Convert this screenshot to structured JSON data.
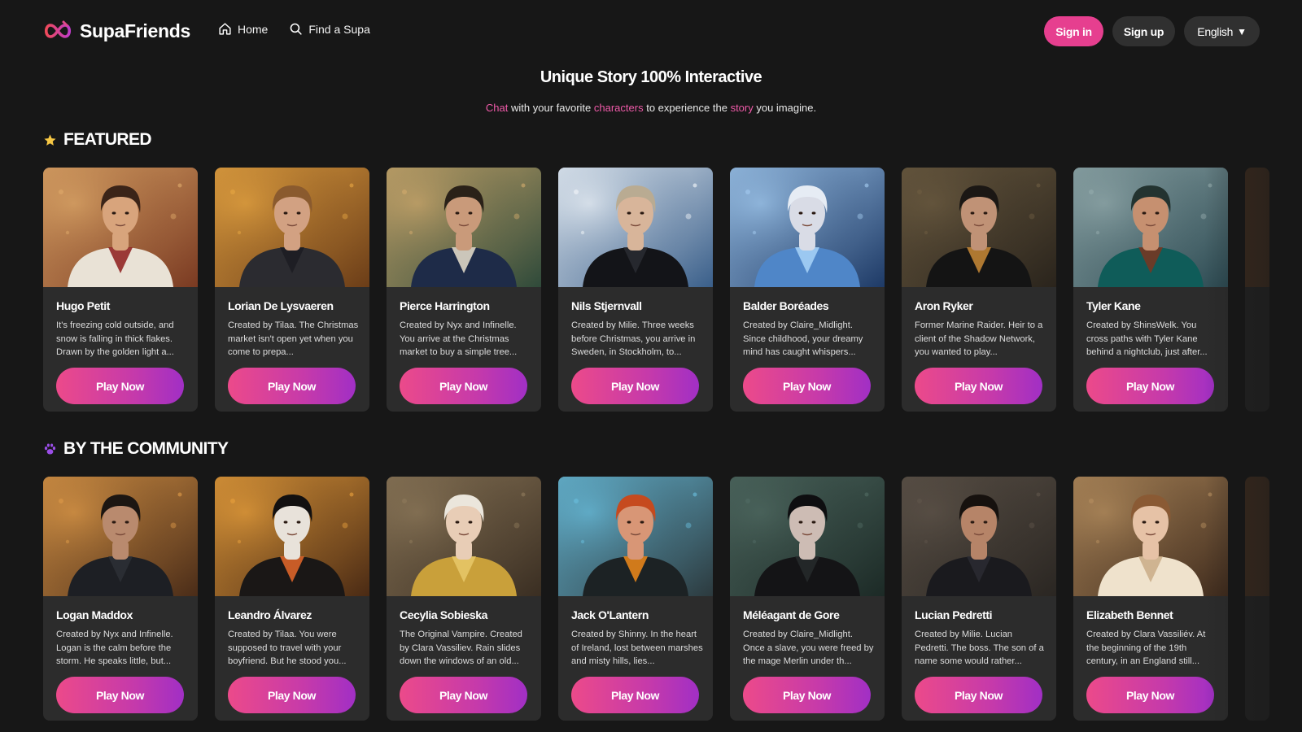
{
  "brand": {
    "name": "SupaFriends",
    "accent": "#e63f8f"
  },
  "nav": {
    "home": {
      "label": "Home",
      "icon": "home-icon"
    },
    "find": {
      "label": "Find a Supa",
      "icon": "search-icon"
    }
  },
  "auth": {
    "sign_in": "Sign in",
    "sign_up": "Sign up"
  },
  "language": {
    "selected": "English",
    "icon": "caret-down-icon"
  },
  "hero": {
    "title": "Unique Story 100% Interactive",
    "sub_parts": [
      "Chat",
      " with your favorite ",
      "characters",
      " to experience the ",
      "story",
      " you imagine."
    ]
  },
  "sections": {
    "featured": {
      "title": "FEATURED",
      "icon": "star-icon",
      "cards": [
        {
          "name": "Hugo Petit",
          "desc": "It's freezing cold outside, and snow is falling in thick flakes. Drawn by the golden light a...",
          "cta": "Play Now",
          "bg": "#7a3a22",
          "bg2": "#d9a466",
          "skin": "#d8a47c",
          "hair": "#3b2418",
          "cloth": "#e9e2d6",
          "accent": "#8d1b1b"
        },
        {
          "name": "Lorian De Lysvaeren",
          "desc": "Created by Tilaa. The Christmas market isn't open yet when you come to prepa...",
          "cta": "Play Now",
          "bg": "#6b3d18",
          "bg2": "#e0a040",
          "skin": "#d2a182",
          "hair": "#8a5a2e",
          "cloth": "#2b2b30",
          "accent": "#1c1c22"
        },
        {
          "name": "Pierce Harrington",
          "desc": "Created by Nyx and Infinelle. You arrive at the Christmas market to buy a simple tree...",
          "cta": "Play Now",
          "bg": "#2f4a3a",
          "bg2": "#c9a56a",
          "skin": "#c99a7a",
          "hair": "#2a2118",
          "cloth": "#1e2b48",
          "accent": "#eae2cf"
        },
        {
          "name": "Nils Stjernvall",
          "desc": "Created by Milie. Three weeks before Christmas, you arrive in Sweden, in Stockholm, to...",
          "cta": "Play Now",
          "bg": "#3a5f8a",
          "bg2": "#e8eef4",
          "skin": "#d8b59a",
          "hair": "#b9ab92",
          "cloth": "#131418",
          "accent": "#2a2c33"
        },
        {
          "name": "Balder Boréades",
          "desc": "Created by Claire_Midlight. Since childhood, your dreamy mind has caught whispers...",
          "cta": "Play Now",
          "bg": "#1e3a66",
          "bg2": "#9cc3e8",
          "skin": "#d9dce6",
          "hair": "#e6ecf4",
          "cloth": "#4f86c8",
          "accent": "#a8d4f8"
        },
        {
          "name": "Aron Ryker",
          "desc": "Former Marine Raider. Heir to a client of the Shadow Network, you wanted to play...",
          "cta": "Play Now",
          "bg": "#2a241c",
          "bg2": "#6a5a40",
          "skin": "#c09276",
          "hair": "#1b1714",
          "cloth": "#141414",
          "accent": "#c98a36"
        },
        {
          "name": "Tyler Kane",
          "desc": "Created by ShinsWelk. You cross paths with Tyler Kane behind a nightclub, just after...",
          "cta": "Play Now",
          "bg": "#2c4a52",
          "bg2": "#8fa6a8",
          "skin": "#c69070",
          "hair": "#233330",
          "cloth": "#0f5c59",
          "accent": "#7a3520"
        }
      ]
    },
    "community": {
      "title": "BY THE COMMUNITY",
      "icon": "paw-icon",
      "cards": [
        {
          "name": "Logan Maddox",
          "desc": "Created by Nyx and Infinelle. Logan is the calm before the storm. He speaks little, but...",
          "cta": "Play Now",
          "bg": "#4a2c18",
          "bg2": "#d69446",
          "skin": "#b98a6e",
          "hair": "#1c1612",
          "cloth": "#1d1f24",
          "accent": "#2d3036"
        },
        {
          "name": "Leandro Álvarez",
          "desc": "Created by Tilaa. You were supposed to travel with your boyfriend. But he stood you...",
          "cta": "Play Now",
          "bg": "#4a2a14",
          "bg2": "#e09a3a",
          "skin": "#e8e2da",
          "hair": "#121010",
          "cloth": "#1a1716",
          "accent": "#e8682a"
        },
        {
          "name": "Cecylia Sobieska",
          "desc": "The Original Vampire. Created by Clara Vassiliev. Rain slides down the windows of an old...",
          "cta": "Play Now",
          "bg": "#3a2e22",
          "bg2": "#8a7658",
          "skin": "#e8cdb6",
          "hair": "#ebe6dc",
          "cloth": "#c9a03a",
          "accent": "#e8c86a"
        },
        {
          "name": "Jack O'Lantern",
          "desc": "Created by Shinny. In the heart of Ireland, lost between marshes and misty hills, lies...",
          "cta": "Play Now",
          "bg": "#2c3a3e",
          "bg2": "#66b8d6",
          "skin": "#d89676",
          "hair": "#c64a1e",
          "cloth": "#1c2224",
          "accent": "#f08a1a"
        },
        {
          "name": "Méléagant de Gore",
          "desc": "Created by Claire_Midlight. Once a slave, you were freed by the mage Merlin under th...",
          "cta": "Play Now",
          "bg": "#1c2a26",
          "bg2": "#4e6860",
          "skin": "#cdbcb4",
          "hair": "#0e0e10",
          "cloth": "#141416",
          "accent": "#262a2c"
        },
        {
          "name": "Lucian Pedretti",
          "desc": "Created by Milie. Lucian Pedretti. The boss. The son of a name some would rather...",
          "cta": "Play Now",
          "bg": "#2a2622",
          "bg2": "#5c5248",
          "skin": "#b68468",
          "hair": "#16110e",
          "cloth": "#1a1a1e",
          "accent": "#2b2c33"
        },
        {
          "name": "Elizabeth Bennet",
          "desc": "Created by Clara Vassiliév. At the beginning of the 19th century, in an England still...",
          "cta": "Play Now",
          "bg": "#3e2a1c",
          "bg2": "#b08a5c",
          "skin": "#e6c2a6",
          "hair": "#8a5a34",
          "cloth": "#efe2cc",
          "accent": "#c9ac86"
        }
      ]
    }
  }
}
